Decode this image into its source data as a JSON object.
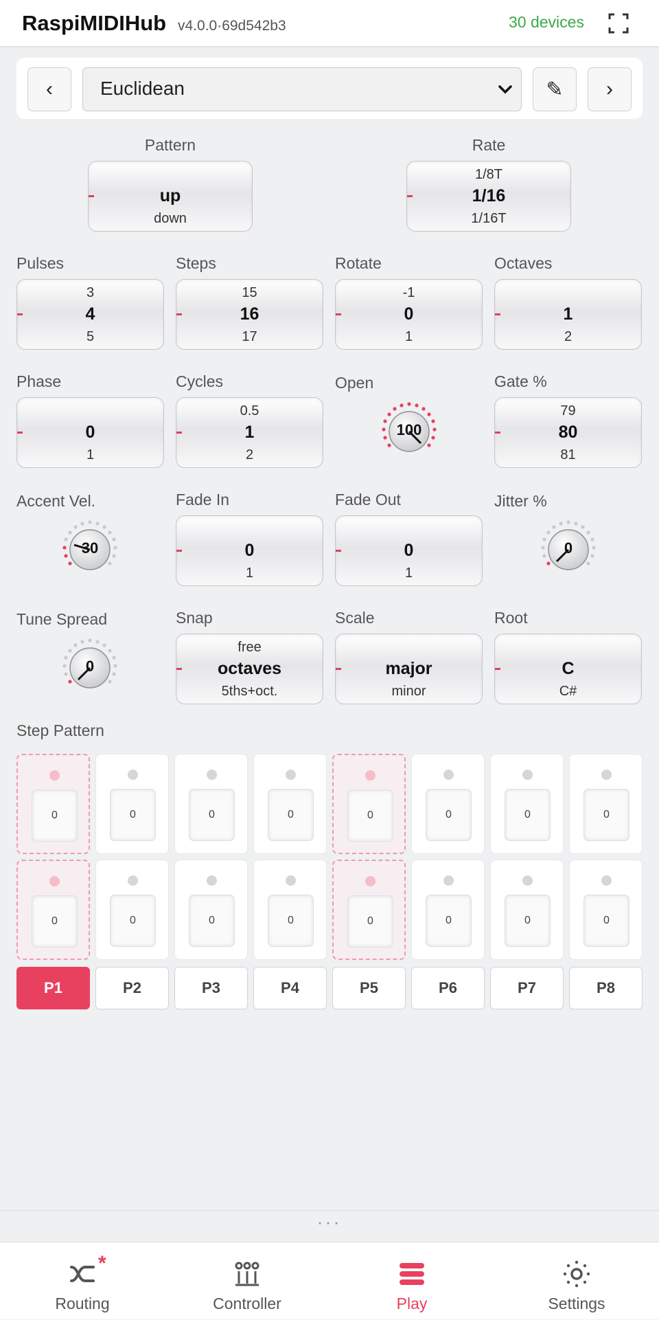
{
  "header": {
    "title": "RaspiMIDIHub",
    "version": "v4.0.0·69d542b3",
    "devices": "30 devices",
    "fullscreen_icon": "fullscreen-icon"
  },
  "preset": {
    "prev_label": "‹",
    "next_label": "›",
    "selected": "Euclidean",
    "edit_icon": "✎"
  },
  "controls": {
    "pattern": {
      "label": "Pattern",
      "prev": "",
      "value": "up",
      "next": "down"
    },
    "rate": {
      "label": "Rate",
      "prev": "1/8T",
      "value": "1/16",
      "next": "1/16T"
    },
    "pulses": {
      "label": "Pulses",
      "prev": "3",
      "value": "4",
      "next": "5"
    },
    "steps": {
      "label": "Steps",
      "prev": "15",
      "value": "16",
      "next": "17"
    },
    "rotate": {
      "label": "Rotate",
      "prev": "-1",
      "value": "0",
      "next": "1"
    },
    "octaves": {
      "label": "Octaves",
      "prev": "",
      "value": "1",
      "next": "2"
    },
    "phase": {
      "label": "Phase",
      "prev": "",
      "value": "0",
      "next": "1"
    },
    "cycles": {
      "label": "Cycles",
      "prev": "0.5",
      "value": "1",
      "next": "2"
    },
    "open": {
      "label": "Open",
      "value": "100"
    },
    "gate": {
      "label": "Gate %",
      "prev": "79",
      "value": "80",
      "next": "81"
    },
    "accent_vel": {
      "label": "Accent Vel.",
      "value": "30"
    },
    "fade_in": {
      "label": "Fade In",
      "prev": "",
      "value": "0",
      "next": "1"
    },
    "fade_out": {
      "label": "Fade Out",
      "prev": "",
      "value": "0",
      "next": "1"
    },
    "jitter": {
      "label": "Jitter %",
      "value": "0"
    },
    "tune_spread": {
      "label": "Tune Spread",
      "value": "0"
    },
    "snap": {
      "label": "Snap",
      "prev": "free",
      "value": "octaves",
      "next": "5ths+oct."
    },
    "scale": {
      "label": "Scale",
      "prev": "",
      "value": "major",
      "next": "minor"
    },
    "root": {
      "label": "Root",
      "prev": "",
      "value": "C",
      "next": "C#"
    }
  },
  "step_pattern": {
    "title": "Step Pattern",
    "steps": [
      {
        "value": "0",
        "active": true
      },
      {
        "value": "0",
        "active": false
      },
      {
        "value": "0",
        "active": false
      },
      {
        "value": "0",
        "active": false
      },
      {
        "value": "0",
        "active": true
      },
      {
        "value": "0",
        "active": false
      },
      {
        "value": "0",
        "active": false
      },
      {
        "value": "0",
        "active": false
      },
      {
        "value": "0",
        "active": true
      },
      {
        "value": "0",
        "active": false
      },
      {
        "value": "0",
        "active": false
      },
      {
        "value": "0",
        "active": false
      },
      {
        "value": "0",
        "active": true
      },
      {
        "value": "0",
        "active": false
      },
      {
        "value": "0",
        "active": false
      },
      {
        "value": "0",
        "active": false
      }
    ],
    "pages": [
      "P1",
      "P2",
      "P3",
      "P4",
      "P5",
      "P6",
      "P7",
      "P8"
    ],
    "selected_page": "P1"
  },
  "handle": "···",
  "tabs": [
    {
      "label": "Routing",
      "icon": "routing-icon",
      "badge": "*"
    },
    {
      "label": "Controller",
      "icon": "controller-icon"
    },
    {
      "label": "Play",
      "icon": "play-icon",
      "active": true
    },
    {
      "label": "Settings",
      "icon": "settings-icon"
    }
  ],
  "colors": {
    "accent": "#e8415f",
    "devices_green": "#3aa94a",
    "background": "#eff0f2"
  }
}
